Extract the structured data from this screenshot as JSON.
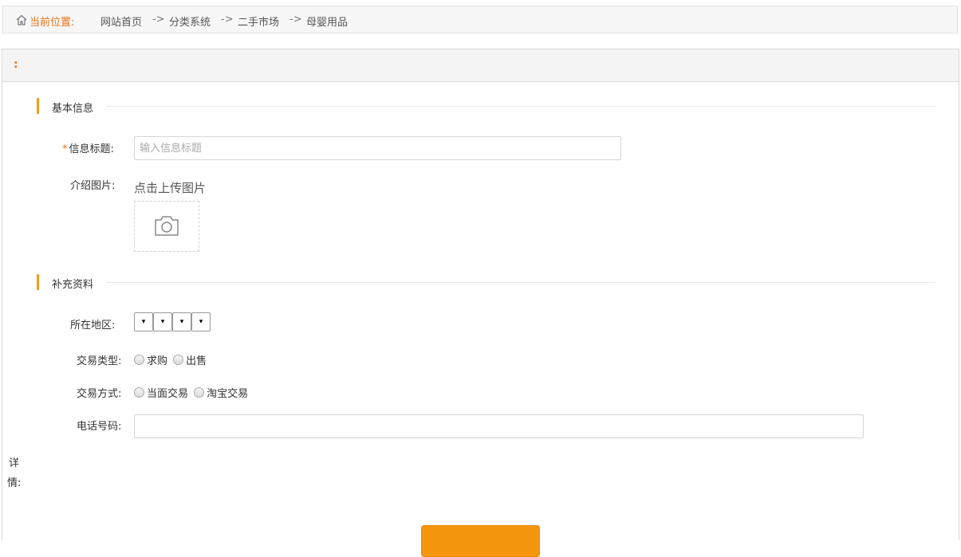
{
  "breadcrumb": {
    "location_label": "当前位置:",
    "items": [
      "网站首页",
      "分类系统",
      "二手市场",
      "母婴用品"
    ],
    "separator": "->"
  },
  "panel": {
    "header_text": ":"
  },
  "sections": {
    "basic": "基本信息",
    "extra": "补充资料"
  },
  "form": {
    "title": {
      "required_mark": "*",
      "label": "信息标题:",
      "placeholder": "输入信息标题",
      "value": ""
    },
    "image": {
      "label": "介绍图片:",
      "upload_text": "点击上传图片"
    },
    "region": {
      "label": "所在地区:",
      "select_glyph": "▾"
    },
    "trade_type": {
      "label": "交易类型:",
      "options": [
        "求购",
        "出售"
      ]
    },
    "trade_method": {
      "label": "交易方式:",
      "options": [
        "当面交易",
        "淘宝交易"
      ]
    },
    "phone": {
      "label": "电话号码:",
      "value": ""
    },
    "detail": {
      "label_line1": "详",
      "label_line2": "情:"
    }
  },
  "colors": {
    "accent": "#e8741a",
    "section_bar": "#f39c12",
    "button": "#f5960f"
  }
}
